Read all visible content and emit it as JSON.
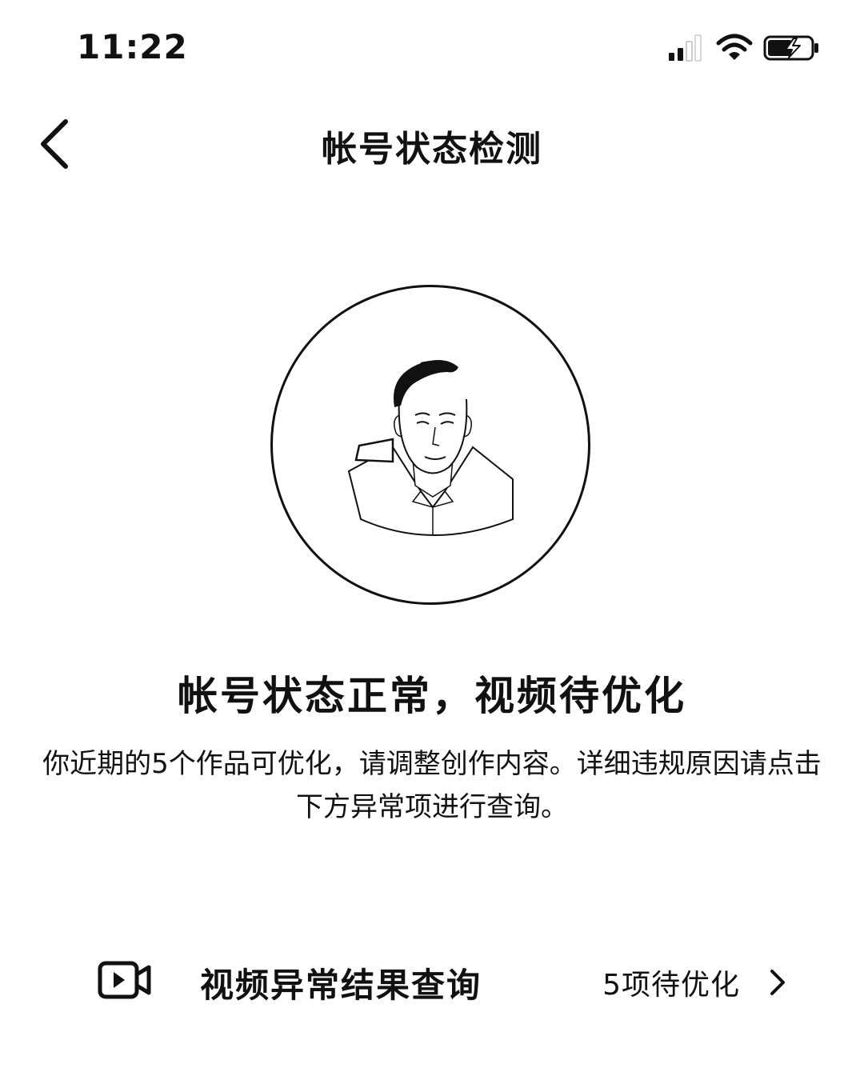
{
  "status_bar": {
    "time": "11:22",
    "icons": [
      "cellular-signal-icon",
      "wifi-icon",
      "battery-charging-icon"
    ]
  },
  "nav": {
    "back_icon": "chevron-left-icon",
    "title": "帐号状态检测"
  },
  "avatar": {
    "description_icon": "user-avatar"
  },
  "status": {
    "title": "帐号状态正常，视频待优化",
    "description": "你近期的5个作品可优化，请调整创作内容。详细违规原因请点击下方异常项进行查询。"
  },
  "result_row": {
    "icon": "video-icon",
    "label": "视频异常结果查询",
    "count": "5项待优化",
    "chevron": "chevron-right-icon"
  },
  "colors": {
    "text": "#111111",
    "background": "#ffffff"
  }
}
